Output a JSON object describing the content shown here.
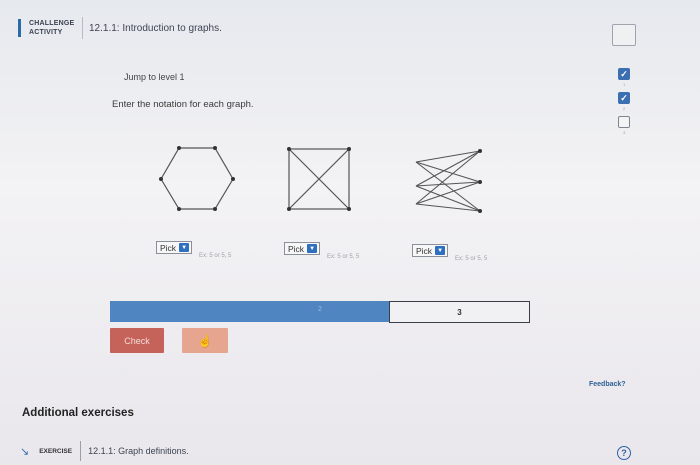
{
  "header": {
    "activity_label_line1": "CHALLENGE",
    "activity_label_line2": "ACTIVITY",
    "title": "12.1.1: Introduction to graphs."
  },
  "jump_label": "Jump to level 1",
  "instructions": "Enter the notation for each graph.",
  "levels": [
    {
      "state": "done",
      "number": "1"
    },
    {
      "state": "done",
      "number": "2"
    },
    {
      "state": "todo",
      "number": "3"
    }
  ],
  "graphs": [
    {
      "pick_label": "Pick",
      "hint": "Ex: 5 or 5, 5"
    },
    {
      "pick_label": "Pick",
      "hint": "Ex: 5 or 5, 5"
    },
    {
      "pick_label": "Pick",
      "hint": "Ex: 5 or 5, 5"
    }
  ],
  "progress": {
    "segment_2_label": "2",
    "segment_3_label": "3"
  },
  "check_label": "Check",
  "feedback_label": "Feedback?",
  "additional_heading": "Additional exercises",
  "exercise": {
    "label": "EXERCISE",
    "title": "12.1.1: Graph definitions."
  },
  "help_symbol": "?",
  "colors": {
    "accent": "#3b6fb1",
    "check_button": "#c5625a",
    "next_button": "#e6a58f",
    "progress_fill": "#4f86c2"
  },
  "icons": {
    "level_done": "checkmark-icon",
    "next": "hand-cursor-icon",
    "exercise": "arrow-icon",
    "help": "help-circle-icon"
  }
}
